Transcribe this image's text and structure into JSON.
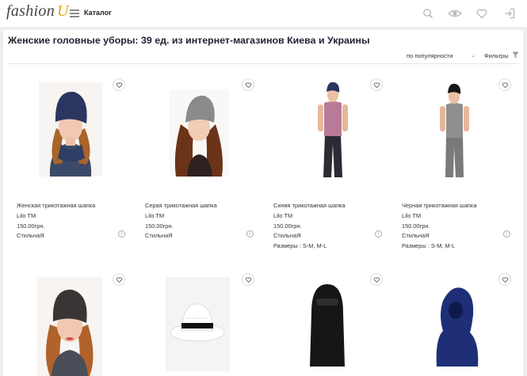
{
  "header": {
    "logo_main": "fashion",
    "logo_accent": "U",
    "catalog_label": "Каталог",
    "icons": [
      "search-icon",
      "eye-icon",
      "heart-icon",
      "login-icon"
    ]
  },
  "page": {
    "title": "Женские головные уборы: 39 ед. из интернет-магазинов Киева и Украины",
    "sort_label": "по популярности",
    "filters_label": "Фильтры"
  },
  "products": [
    {
      "name": "Женская трикотажная шапка",
      "brand": "Lilo TM",
      "price": "150.00грн.",
      "shop": "СтильнаЯ",
      "sizes": ""
    },
    {
      "name": "Серая трикотажная шапка",
      "brand": "Lilo TM",
      "price": "150.00грн.",
      "shop": "СтильнаЯ",
      "sizes": ""
    },
    {
      "name": "Синяя трикотажная шапка",
      "brand": "Lilo TM",
      "price": "150.00грн.",
      "shop": "СтильнаЯ",
      "sizes": "Размеры : S-M, M-L"
    },
    {
      "name": "Черная трикотажная шапка",
      "brand": "Lilo TM",
      "price": "150.00грн.",
      "shop": "СтильнаЯ",
      "sizes": "Размеры : S-M, M-L"
    }
  ],
  "colors": {
    "accent": "#e0a800",
    "hat_navy": "#2a3560",
    "hat_gray": "#8a8a8a",
    "hat_black": "#161616",
    "balaclava_blue": "#1e2f78"
  }
}
